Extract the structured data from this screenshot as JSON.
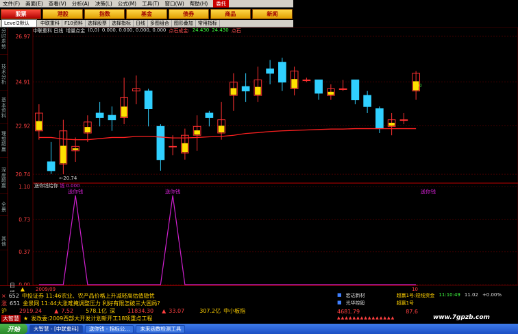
{
  "menu": [
    "文件(F)",
    "画面(E)",
    "查看(V)",
    "分析(A)",
    "决策(L)",
    "公式(M)",
    "工具(T)",
    "窗口(W)",
    "帮助(H)"
  ],
  "menu_alert": "委托",
  "nav_buttons": [
    "股票",
    "港股",
    "指数",
    "基金",
    "债券",
    "商品",
    "新闻"
  ],
  "toolbar": {
    "selector": "Level2默认",
    "items": [
      "中联重科",
      "F10资料",
      "选择股票",
      "选择指标",
      "日线",
      "多图组合",
      "图形叠加",
      "常用指标"
    ]
  },
  "left_tabs": [
    "分时走势",
    "技术分析",
    "基本资料",
    "理想超赢",
    "深度超赢",
    "全景",
    "其他"
  ],
  "chart_info": {
    "stock": "中联重科 日线",
    "indicator": "增量点金",
    "params": "(0,0)",
    "values": "0.000, 0.000, 0.000, 0.000",
    "level_label": "点石成金:",
    "level1": "24.430",
    "level2": "24.430",
    "level3": "点石"
  },
  "price_axis": [
    "26.97",
    "24.91",
    "22.92",
    "20.74"
  ],
  "low_marker": "←20.74",
  "indicator": {
    "name": "送你钱给你",
    "name_suffix": "钱",
    "value": "0.000",
    "peak_label": "送你钱",
    "axis": [
      "1.10",
      "0.73",
      "0.37",
      "0.00"
    ]
  },
  "right_marker": "0",
  "chart_data": {
    "type": "candlestick",
    "candles": [
      {
        "o": 22.7,
        "c": 23.5,
        "h": 23.9,
        "l": 22.3
      },
      {
        "o": 21.3,
        "c": 20.9,
        "h": 22.2,
        "l": 20.75
      },
      {
        "o": 21.2,
        "c": 22.7,
        "h": 23.2,
        "l": 20.74
      },
      {
        "o": 21.8,
        "c": 22.0,
        "h": 22.4,
        "l": 21.3
      },
      {
        "o": 22.6,
        "c": 23.1,
        "h": 23.4,
        "l": 22.2
      },
      {
        "o": 23.5,
        "c": 23.3,
        "h": 24.0,
        "l": 22.9
      },
      {
        "o": 23.4,
        "c": 23.2,
        "h": 23.8,
        "l": 22.7
      },
      {
        "o": 23.3,
        "c": 24.2,
        "h": 25.1,
        "l": 23.0
      },
      {
        "o": 24.5,
        "c": 24.6,
        "h": 25.2,
        "l": 23.9
      },
      {
        "o": 24.5,
        "c": 23.7,
        "h": 24.6,
        "l": 22.9
      },
      {
        "o": 22.9,
        "c": 21.4,
        "h": 23.0,
        "l": 20.9
      },
      {
        "o": 22.0,
        "c": 22.0,
        "h": 22.5,
        "l": 21.6
      },
      {
        "o": 21.7,
        "c": 22.5,
        "h": 22.8,
        "l": 21.4
      },
      {
        "o": 22.5,
        "c": 22.9,
        "h": 23.4,
        "l": 21.8
      },
      {
        "o": 23.5,
        "c": 23.3,
        "h": 23.6,
        "l": 22.9
      },
      {
        "o": 22.6,
        "c": 23.2,
        "h": 24.0,
        "l": 22.3
      },
      {
        "o": 24.3,
        "c": 24.9,
        "h": 25.3,
        "l": 23.6
      },
      {
        "o": 24.7,
        "c": 24.5,
        "h": 25.3,
        "l": 24.0
      },
      {
        "o": 24.3,
        "c": 25.0,
        "h": 25.6,
        "l": 24.0
      },
      {
        "o": 25.5,
        "c": 25.3,
        "h": 25.9,
        "l": 24.8
      },
      {
        "o": 25.8,
        "c": 24.9,
        "h": 26.0,
        "l": 24.5
      },
      {
        "o": 24.6,
        "c": 25.4,
        "h": 25.6,
        "l": 24.3
      },
      {
        "o": 25.0,
        "c": 25.0,
        "h": 25.1,
        "l": 24.9
      },
      {
        "o": 25.0,
        "c": 24.4,
        "h": 25.0,
        "l": 24.1
      },
      {
        "o": 24.3,
        "c": 24.6,
        "h": 24.8,
        "l": 24.1
      },
      {
        "o": 24.6,
        "c": 24.6,
        "h": 25.0,
        "l": 24.5
      },
      {
        "o": 25.0,
        "c": 24.1,
        "h": 25.0,
        "l": 23.9
      },
      {
        "o": 24.3,
        "c": 23.8,
        "h": 24.5,
        "l": 23.5
      },
      {
        "o": 23.7,
        "c": 22.8,
        "h": 23.8,
        "l": 22.6
      },
      {
        "o": 22.9,
        "c": 23.2,
        "h": 23.5,
        "l": 22.5
      },
      {
        "o": 23.2,
        "c": 23.2,
        "h": 23.5,
        "l": 23.0
      },
      {
        "o": 24.5,
        "c": 25.3,
        "h": 25.4,
        "l": 24.1
      }
    ],
    "ma_line": [
      22.4,
      22.4,
      22.33,
      22.3,
      22.3,
      22.35,
      22.4,
      22.4,
      22.45,
      22.45,
      22.42,
      22.38,
      22.38,
      22.4,
      22.43,
      22.45,
      22.5,
      22.58,
      22.62,
      22.67,
      22.7,
      22.72,
      22.74,
      22.76,
      22.78,
      22.78,
      22.8,
      22.8,
      22.8,
      22.8,
      22.8,
      22.8
    ],
    "price_range": [
      20.4,
      27.0
    ],
    "indicator_values": [
      0,
      0,
      0,
      0,
      0,
      0,
      0,
      0,
      0,
      0,
      0,
      0,
      0,
      0,
      0,
      0,
      0,
      0,
      0,
      0,
      0,
      0,
      0,
      0,
      0,
      0,
      0,
      0,
      0,
      0,
      0,
      0
    ],
    "indicator_spikes": [
      3,
      11,
      32
    ],
    "indicator_range": [
      0,
      1.1
    ]
  },
  "bottom_tabs": {
    "label": "日线",
    "date_left": "2009/09",
    "date_right": "10"
  },
  "ticker": [
    {
      "icon": "×",
      "code": "652",
      "text": "中投证券 11:46农业、农产品价格上升减轻高估值隐忧"
    },
    {
      "icon": "涨",
      "code": "651",
      "text": "金景网 11:44大涨难掩调整压力 利好有限怎破三大困局?"
    },
    {
      "label": "沪",
      "price": "2919.24",
      "change": "7.52",
      "amount": "578.1亿",
      "label2": "深",
      "price2": "11834.30",
      "change2": "33.07",
      "amount2": "307.2亿",
      "label3": "中小板指"
    },
    {
      "label": "大智慧",
      "text": "发改委:2009西部大开发计划新开工18项重点工程"
    }
  ],
  "right_ticker": [
    {
      "name": "宏达新材",
      "code": "超赢1号:短线资金",
      "time": "11:10:49",
      "v1": "11.02",
      "v2": "+0.00%"
    },
    {
      "name": "光华控股",
      "code": "超赢1号",
      "time": "",
      "v1": "",
      "v2": ""
    }
  ],
  "right_price": {
    "value": "4681.79",
    "value2": "87.6"
  },
  "taskbar": {
    "start": "开始",
    "tasks": [
      "大智慧 - [中联重科]",
      "送你钱 - 指标公...",
      "未来函数检测工具"
    ]
  },
  "watermark": "www.7gpzb.com",
  "colors": {
    "up": "#ff3030",
    "down": "#30d0ff",
    "yellow_body": "#ffe000",
    "ma": "#ff2020",
    "indicator": "#d020d0",
    "grid": "#700000"
  }
}
